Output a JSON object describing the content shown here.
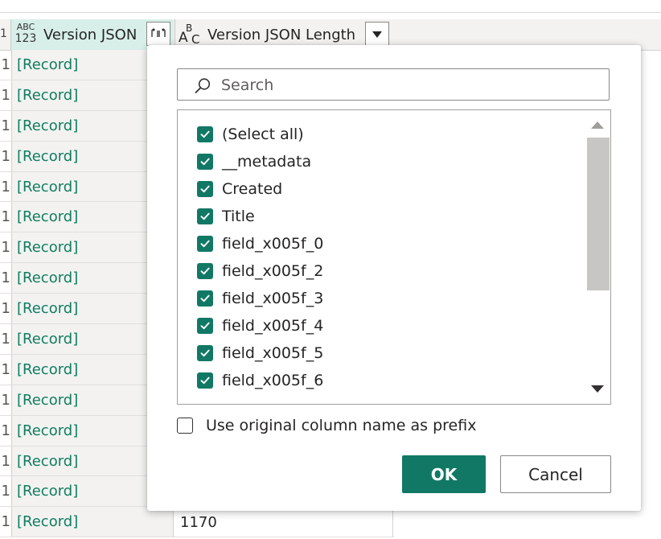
{
  "grid": {
    "columns": [
      {
        "type_top": "ABC",
        "type_bottom": "123",
        "title": "Version JSON",
        "expand_icon": "expand-columns-icon"
      },
      {
        "type_letters": [
          "A",
          "B",
          "C"
        ],
        "title": "Version JSON Length",
        "filter_icon": "dropdown-arrow-icon"
      }
    ],
    "row_index_glyph": "1",
    "record_label": "[Record]",
    "rows": [
      {
        "value": "[Record]",
        "length": ""
      },
      {
        "value": "[Record]",
        "length": ""
      },
      {
        "value": "[Record]",
        "length": ""
      },
      {
        "value": "[Record]",
        "length": ""
      },
      {
        "value": "[Record]",
        "length": ""
      },
      {
        "value": "[Record]",
        "length": ""
      },
      {
        "value": "[Record]",
        "length": ""
      },
      {
        "value": "[Record]",
        "length": ""
      },
      {
        "value": "[Record]",
        "length": ""
      },
      {
        "value": "[Record]",
        "length": ""
      },
      {
        "value": "[Record]",
        "length": ""
      },
      {
        "value": "[Record]",
        "length": ""
      },
      {
        "value": "[Record]",
        "length": ""
      },
      {
        "value": "[Record]",
        "length": ""
      },
      {
        "value": "[Record]",
        "length": ""
      },
      {
        "value": "[Record]",
        "length": "1170"
      }
    ]
  },
  "popup": {
    "search": {
      "placeholder": "Search",
      "value": "",
      "icon": "search-icon"
    },
    "items": [
      {
        "label": "(Select all)",
        "checked": true
      },
      {
        "label": "__metadata",
        "checked": true
      },
      {
        "label": "Created",
        "checked": true
      },
      {
        "label": "Title",
        "checked": true
      },
      {
        "label": "field_x005f_0",
        "checked": true
      },
      {
        "label": "field_x005f_2",
        "checked": true
      },
      {
        "label": "field_x005f_3",
        "checked": true
      },
      {
        "label": "field_x005f_4",
        "checked": true
      },
      {
        "label": "field_x005f_5",
        "checked": true
      },
      {
        "label": "field_x005f_6",
        "checked": true
      }
    ],
    "prefix_option": {
      "label": "Use original column name as prefix",
      "checked": false
    },
    "ok_label": "OK",
    "cancel_label": "Cancel"
  },
  "colors": {
    "accent": "#117865",
    "record_text": "#0f7d5f",
    "selected_header": "#d8efe9"
  }
}
